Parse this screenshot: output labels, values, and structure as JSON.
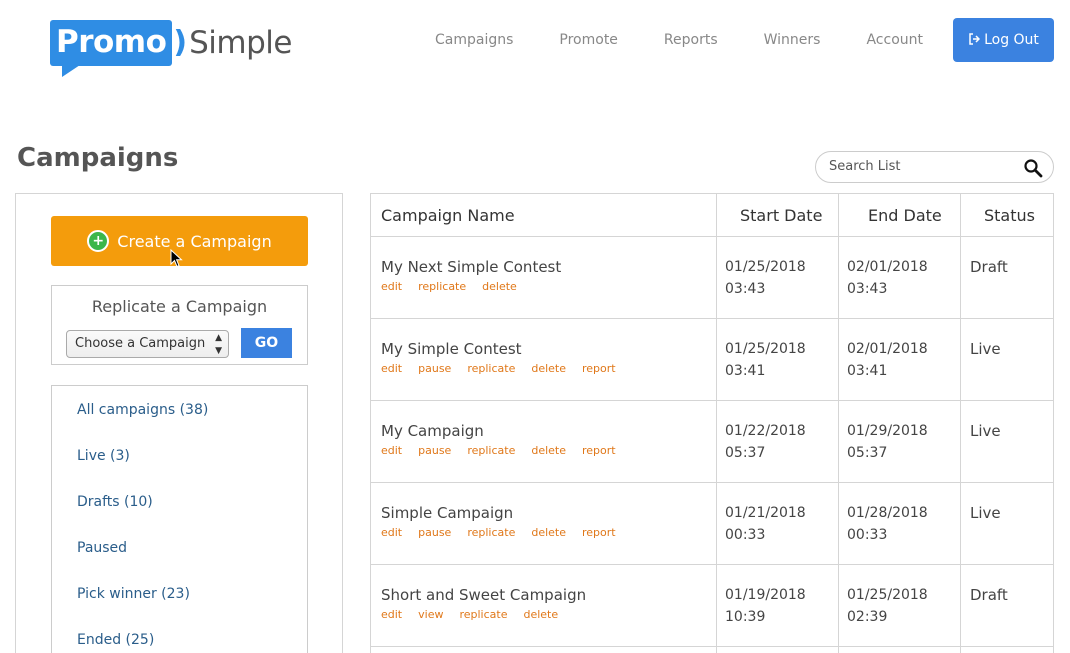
{
  "header": {
    "logo": {
      "part1": "Promo",
      "part2": "Simple"
    },
    "nav": [
      "Campaigns",
      "Promote",
      "Reports",
      "Winners",
      "Account"
    ],
    "logout_label": "Log Out"
  },
  "page": {
    "title": "Campaigns",
    "search_placeholder": "Search List"
  },
  "sidebar": {
    "create_label": "Create a Campaign",
    "replicate_title": "Replicate a Campaign",
    "select_value": "Choose a Campaign",
    "go_label": "GO",
    "filters": [
      "All campaigns (38)",
      "Live (3)",
      "Drafts (10)",
      "Paused",
      "Pick winner (23)",
      "Ended (25)"
    ]
  },
  "table": {
    "headers": [
      "Campaign Name",
      "Start Date",
      "End Date",
      "Status"
    ],
    "rows": [
      {
        "name": "My Next Simple Contest",
        "actions": [
          "edit",
          "replicate",
          "delete"
        ],
        "start_date": "01/25/2018",
        "start_time": "03:43",
        "end_date": "02/01/2018",
        "end_time": "03:43",
        "status": "Draft"
      },
      {
        "name": "My Simple Contest",
        "actions": [
          "edit",
          "pause",
          "replicate",
          "delete",
          "report"
        ],
        "start_date": "01/25/2018",
        "start_time": "03:41",
        "end_date": "02/01/2018",
        "end_time": "03:41",
        "status": "Live"
      },
      {
        "name": "My Campaign",
        "actions": [
          "edit",
          "pause",
          "replicate",
          "delete",
          "report"
        ],
        "start_date": "01/22/2018",
        "start_time": "05:37",
        "end_date": "01/29/2018",
        "end_time": "05:37",
        "status": "Live"
      },
      {
        "name": "Simple Campaign",
        "actions": [
          "edit",
          "pause",
          "replicate",
          "delete",
          "report"
        ],
        "start_date": "01/21/2018",
        "start_time": "00:33",
        "end_date": "01/28/2018",
        "end_time": "00:33",
        "status": "Live"
      },
      {
        "name": "Short and Sweet Campaign",
        "actions": [
          "edit",
          "view",
          "replicate",
          "delete"
        ],
        "start_date": "01/19/2018",
        "start_time": "10:39",
        "end_date": "01/25/2018",
        "end_time": "02:39",
        "status": "Draft"
      }
    ]
  },
  "colors": {
    "brand_blue": "#2f8de4",
    "button_blue": "#3b82e0",
    "orange": "#f49c0c",
    "action_orange": "#e0781a",
    "link_blue": "#2a5d8a"
  }
}
